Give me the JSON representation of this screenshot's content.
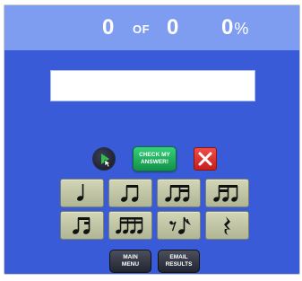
{
  "score": {
    "correct": "0",
    "of_label": "OF",
    "total": "0",
    "percent": "0",
    "percent_sign": "%"
  },
  "answer_box": {
    "value": ""
  },
  "controls": {
    "play_icon": "play-speaker-icon",
    "check_line1": "CHECK MY",
    "check_line2": "ANSWER!",
    "close_icon": "x-icon"
  },
  "rhythm_buttons": [
    {
      "icon": "quarter-note-icon"
    },
    {
      "icon": "two-eighth-notes-icon"
    },
    {
      "icon": "eighth-two-sixteenths-icon"
    },
    {
      "icon": "two-sixteenths-eighth-icon"
    },
    {
      "icon": "sixteenth-sixteenth-eighth-icon"
    },
    {
      "icon": "four-sixteenth-notes-icon"
    },
    {
      "icon": "eighth-rest-eighth-note-icon"
    },
    {
      "icon": "quarter-rest-icon"
    }
  ],
  "menu": {
    "main_line1": "MAIN",
    "main_line2": "MENU",
    "email_line1": "EMAIL",
    "email_line2": "RESULTS"
  },
  "colors": {
    "background": "#3a5bd8",
    "header": "#7f9df0",
    "check_button": "#1fb35e",
    "close_button": "#d92a28",
    "rhythm_button": "#c1c6a6",
    "menu_button": "#2f3240"
  }
}
